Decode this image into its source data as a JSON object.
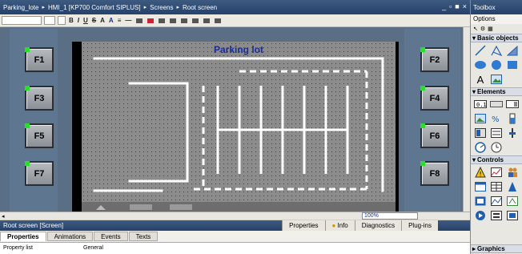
{
  "title_bar": {
    "breadcrumbs": [
      "Parking_lote",
      "HMI_1 [KP700 Comfort SIPLUS]",
      "Screens",
      "Root screen"
    ],
    "window_controls": [
      "_",
      "▫",
      "■",
      "×"
    ]
  },
  "format_toolbar": {
    "buttons": [
      "B",
      "I",
      "U",
      "S",
      "A",
      "A",
      "≡",
      "—"
    ]
  },
  "editor": {
    "screen_title": "Parking lot",
    "function_keys_left": [
      "F1",
      "F3",
      "F5",
      "F7"
    ],
    "function_keys_right": [
      "F2",
      "F4",
      "F6",
      "F8"
    ],
    "zoom": "100%"
  },
  "inspector": {
    "header": "Root screen [Screen]",
    "right_tabs": [
      "Properties",
      "Info",
      "Diagnostics",
      "Plug-ins"
    ],
    "sub_tabs": [
      "Properties",
      "Animations",
      "Events",
      "Texts"
    ],
    "left_list_item": "Property list",
    "section_label": "General"
  },
  "toolbox": {
    "title": "Toolbox",
    "options_label": "Options",
    "sections": [
      "Basic objects",
      "Elements",
      "Controls",
      "Graphics"
    ]
  }
}
